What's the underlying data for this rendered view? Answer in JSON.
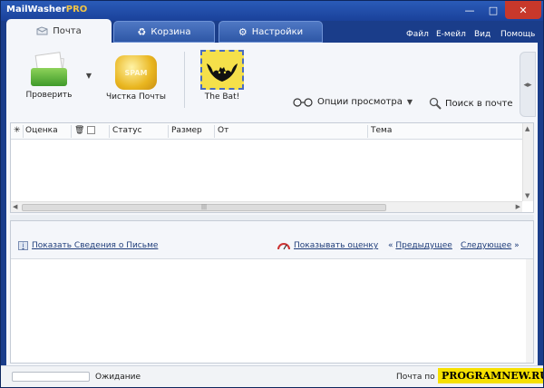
{
  "window": {
    "title_main": "MailWasher",
    "title_pro": "PRO",
    "minimize": "—",
    "maximize": "□",
    "close": "✕"
  },
  "tabs": [
    {
      "label": "Почта",
      "icon": "mail-icon"
    },
    {
      "label": "Корзина",
      "icon": "recycle-icon"
    },
    {
      "label": "Настройки",
      "icon": "gear-icon"
    }
  ],
  "menu": {
    "file": "Файл",
    "email": "E-мейл",
    "view": "Вид",
    "help": "Помощь"
  },
  "toolbar": {
    "check_label": "Проверить",
    "cleanup_label": "Чистка Почты",
    "spam_badge": "SPAM",
    "bat_label": "The Bat!",
    "view_options_label": "Опции просмотра",
    "search_label": "Поиск в почте",
    "collapse_glyph": "◂▸"
  },
  "list": {
    "columns": [
      "Оценка",
      "Статус",
      "Размер",
      "От",
      "Тема"
    ]
  },
  "preview": {
    "show_info_label": "Показать Сведения о Письме",
    "show_rating_label": "Показывать оценку",
    "prev_label": "Предыдущее",
    "next_label": "Следующее",
    "prev_glyph": "«",
    "next_glyph": "»"
  },
  "status": {
    "progress": 0,
    "state_text": "Ожидание",
    "mail_text": "Почта по"
  },
  "watermark": "PROGRAMNEW.RU",
  "colors": {
    "frame": "#1a3d8a",
    "accent_pro": "#f2c544",
    "close_red": "#c8382b",
    "link": "#1f3d7a"
  }
}
